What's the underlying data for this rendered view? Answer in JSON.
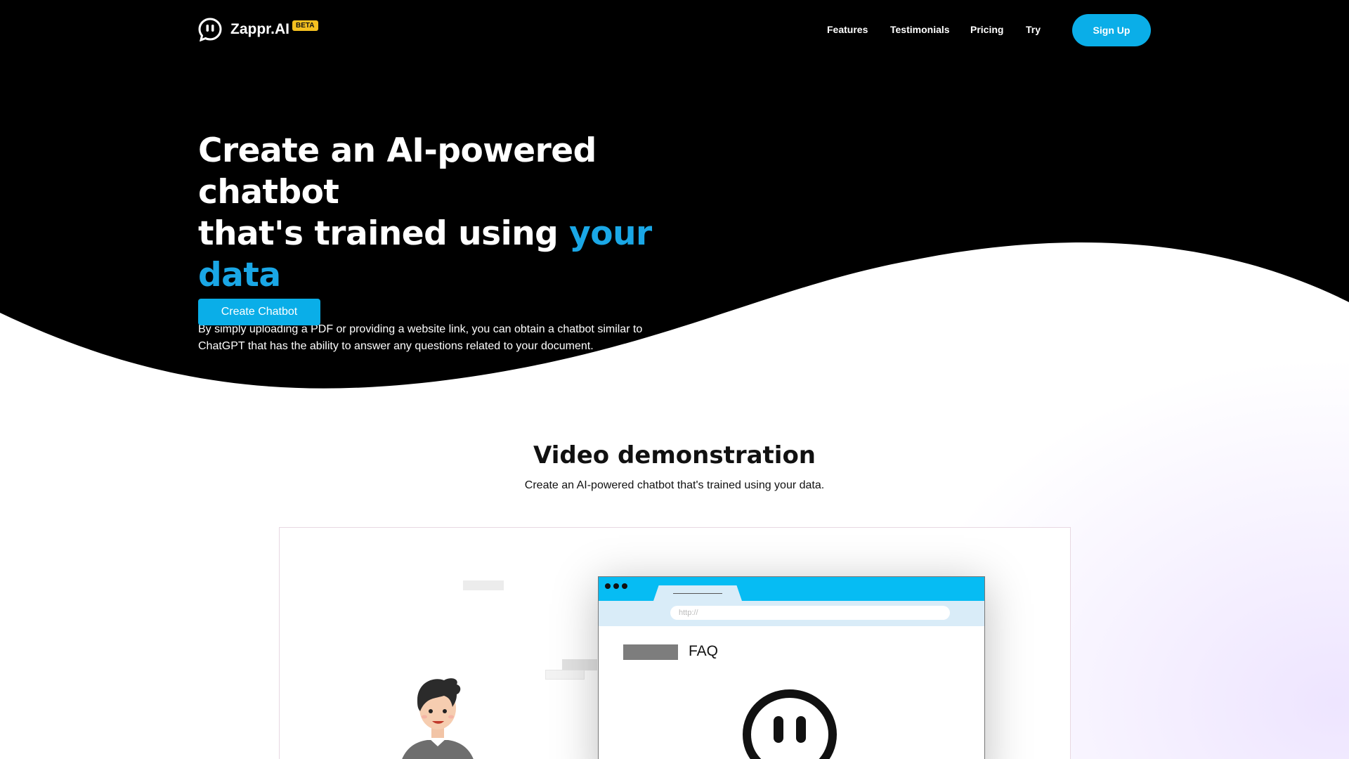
{
  "brand": {
    "name": "Zappr.AI",
    "badge": "BETA"
  },
  "nav": {
    "features": "Features",
    "testimonials": "Testimonials",
    "pricing": "Pricing",
    "try": "Try",
    "signup": "Sign Up"
  },
  "hero": {
    "title_line1": "Create an AI-powered chatbot",
    "title_line2_prefix": "that's trained using ",
    "title_line2_accent": "your data",
    "subtitle_line1": "By simply uploading a PDF or providing a website link, you can obtain a chatbot similar to",
    "subtitle_line2": "ChatGPT that has the ability to answer any questions related to your document.",
    "cta": "Create Chatbot"
  },
  "video": {
    "title": "Video demonstration",
    "subtitle": "Create an AI-powered chatbot that's trained using your data.",
    "browser_url": "http://",
    "faq_label": "FAQ"
  },
  "colors": {
    "accent": "#0aaee8",
    "hero_bg": "#000000",
    "badge": "#f4c020"
  }
}
